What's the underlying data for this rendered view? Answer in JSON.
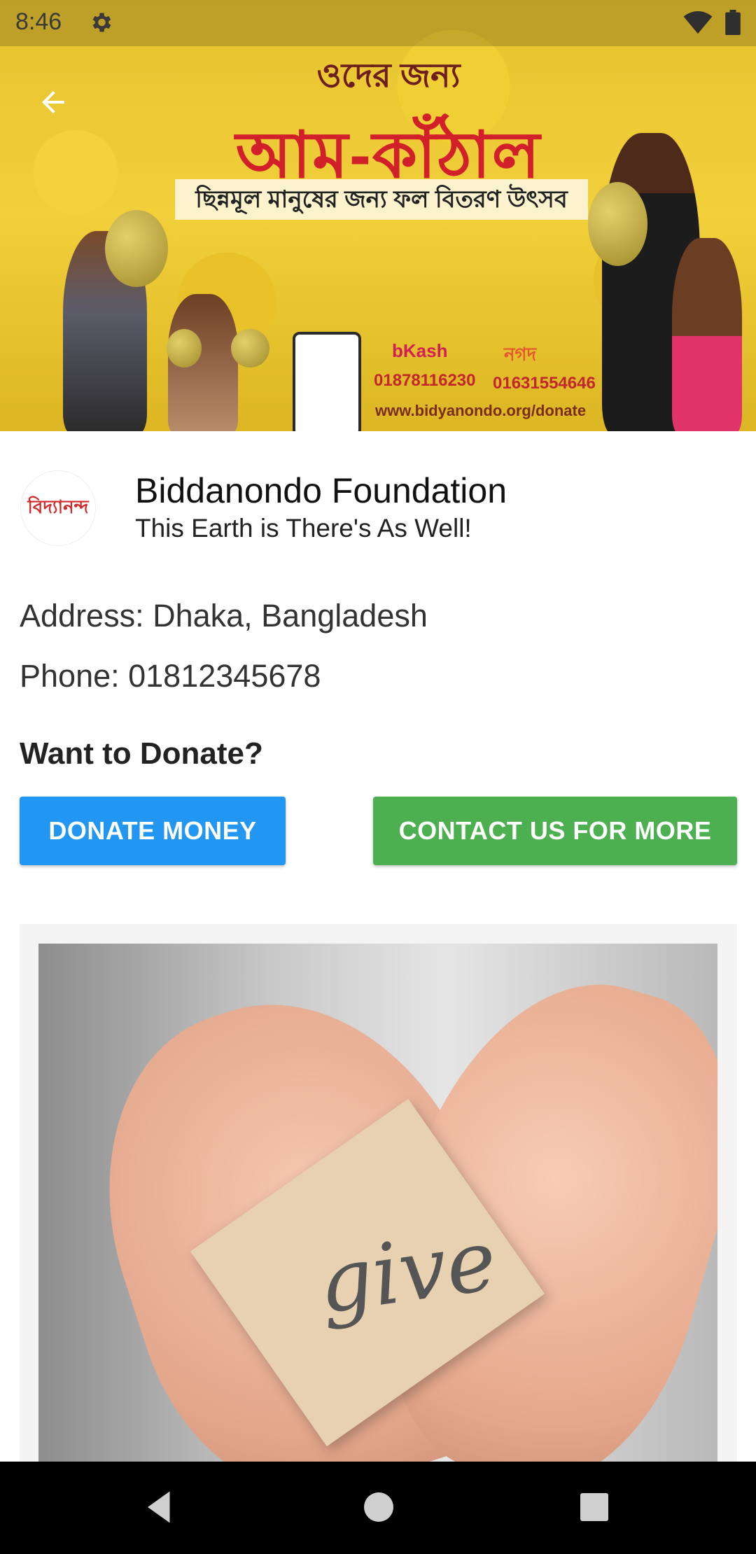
{
  "status_bar": {
    "time": "8:46"
  },
  "banner": {
    "headline_small": "ওদের জন্য",
    "headline": "আম-কাঁঠাল",
    "subheadline": "ছিন্নমূল মানুষের জন্য ফল বিতরণ উৎসব",
    "bkash_label": "bKash",
    "nagad_label": "নগদ",
    "bkash_number": "01878116230",
    "nagad_number": "01631554646",
    "url": "www.bidyanondo.org/donate"
  },
  "org": {
    "logo_text": "বিদ্যানন্দ",
    "name": "Biddanondo Foundation",
    "tagline": "This Earth is There's As Well!"
  },
  "info": {
    "address": "Address: Dhaka, Bangladesh",
    "phone": "Phone: 01812345678"
  },
  "donate": {
    "heading": "Want to Donate?",
    "donate_money_label": "DONATE MONEY",
    "contact_label": "CONTACT US FOR MORE"
  },
  "card": {
    "image_text": "give"
  },
  "colors": {
    "donate_button": "#2196f3",
    "contact_button": "#4caf50"
  }
}
